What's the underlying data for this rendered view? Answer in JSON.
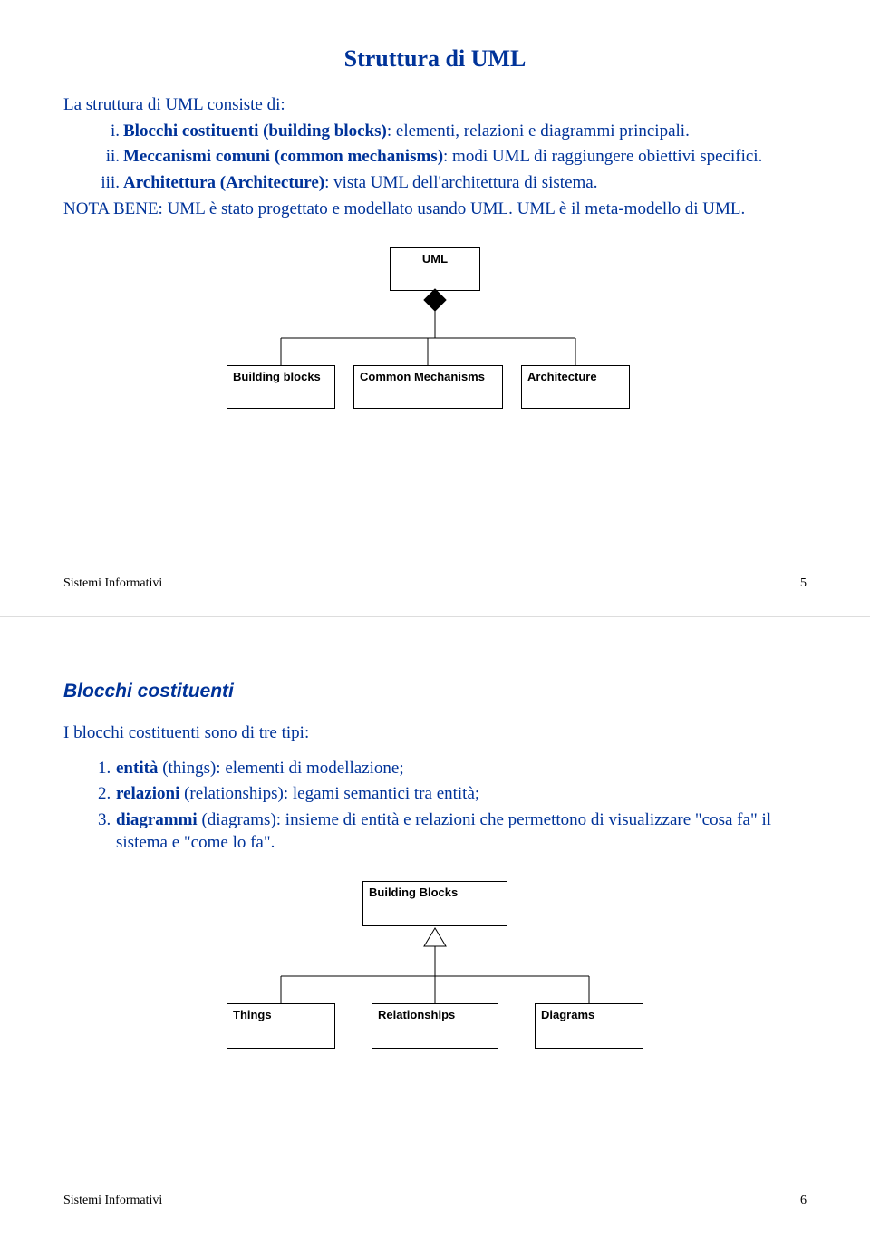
{
  "slide1": {
    "title": "Struttura di UML",
    "intro": "La struttura di UML consiste di:",
    "items": [
      {
        "marker": "i.",
        "bold": "Blocchi costituenti (building blocks)",
        "rest": ": elementi, relazioni e diagrammi principali."
      },
      {
        "marker": "ii.",
        "bold": "Meccanismi comuni (common mechanisms)",
        "rest": ": modi UML di raggiungere obiettivi specifici."
      },
      {
        "marker": "iii.",
        "bold": "Architettura (Architecture)",
        "rest": ": vista UML dell'architettura di sistema."
      }
    ],
    "note": "NOTA BENE: UML è stato progettato e modellato usando UML. UML è il meta-modello di UML.",
    "diagram": {
      "root": "UML",
      "children": [
        "Building blocks",
        "Common Mechanisms",
        "Architecture"
      ]
    },
    "footer_left": "Sistemi Informativi",
    "footer_right": "5"
  },
  "slide2": {
    "title": "Blocchi costituenti",
    "intro": "I blocchi costituenti sono di tre tipi:",
    "items": [
      {
        "marker": "1.",
        "bold": "entità",
        "rest": " (things): elementi di modellazione;"
      },
      {
        "marker": "2.",
        "bold": "relazioni",
        "rest": " (relationships): legami semantici tra entità;"
      },
      {
        "marker": "3.",
        "bold": "diagrammi",
        "rest": " (diagrams): insieme di entità e relazioni che permettono di visualizzare \"cosa fa\" il sistema e \"come lo fa\"."
      }
    ],
    "diagram": {
      "root": "Building Blocks",
      "children": [
        "Things",
        "Relationships",
        "Diagrams"
      ]
    },
    "footer_left": "Sistemi Informativi",
    "footer_right": "6"
  }
}
